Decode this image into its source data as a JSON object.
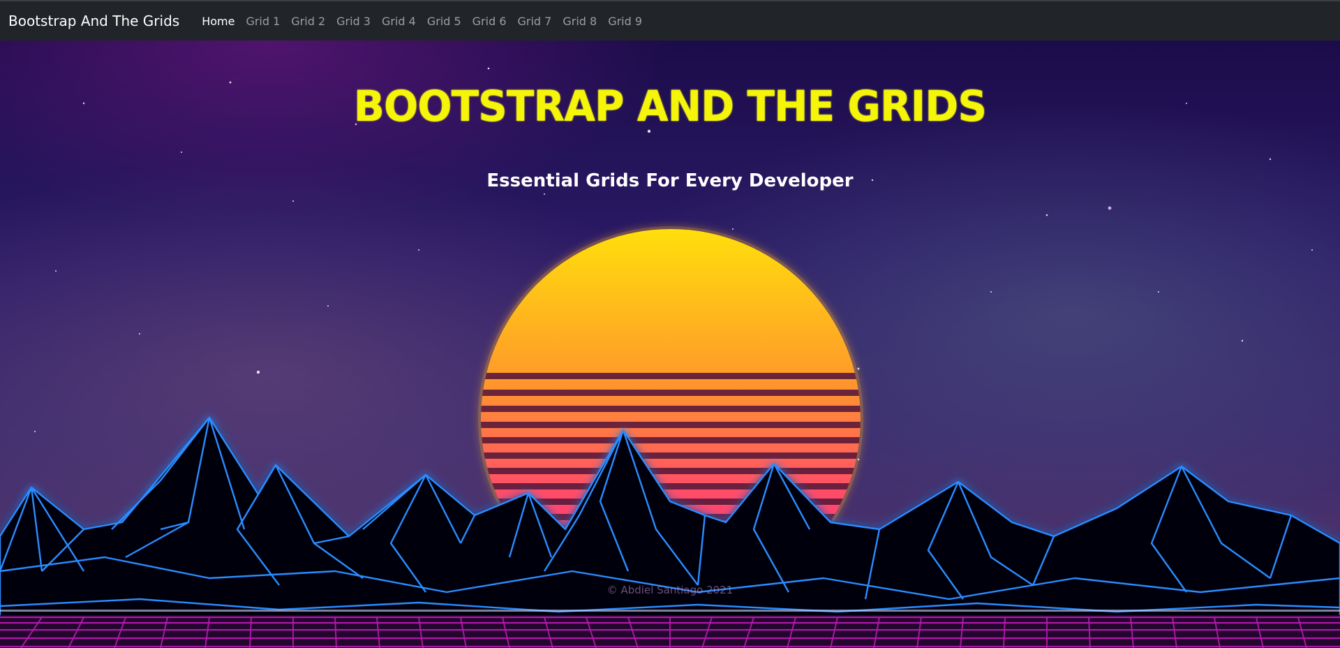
{
  "navbar": {
    "brand": "Bootstrap And The Grids",
    "links": [
      {
        "label": "Home",
        "active": true
      },
      {
        "label": "Grid 1",
        "active": false
      },
      {
        "label": "Grid 2",
        "active": false
      },
      {
        "label": "Grid 3",
        "active": false
      },
      {
        "label": "Grid 4",
        "active": false
      },
      {
        "label": "Grid 5",
        "active": false
      },
      {
        "label": "Grid 6",
        "active": false
      },
      {
        "label": "Grid 7",
        "active": false
      },
      {
        "label": "Grid 8",
        "active": false
      },
      {
        "label": "Grid 9",
        "active": false
      }
    ]
  },
  "hero": {
    "title": "BOOTSTRAP AND THE GRIDS",
    "subtitle": "Essential Grids For Every Developer",
    "background_icon": "synthwave-sunset-image"
  },
  "footer": {
    "copyright": "© Abdiel Santiago 2021"
  },
  "colors": {
    "navbar_bg": "#212529",
    "title_yellow": "#f5f50a",
    "grid_blue": "#1e88ff",
    "floor_magenta": "#e21fd8"
  }
}
